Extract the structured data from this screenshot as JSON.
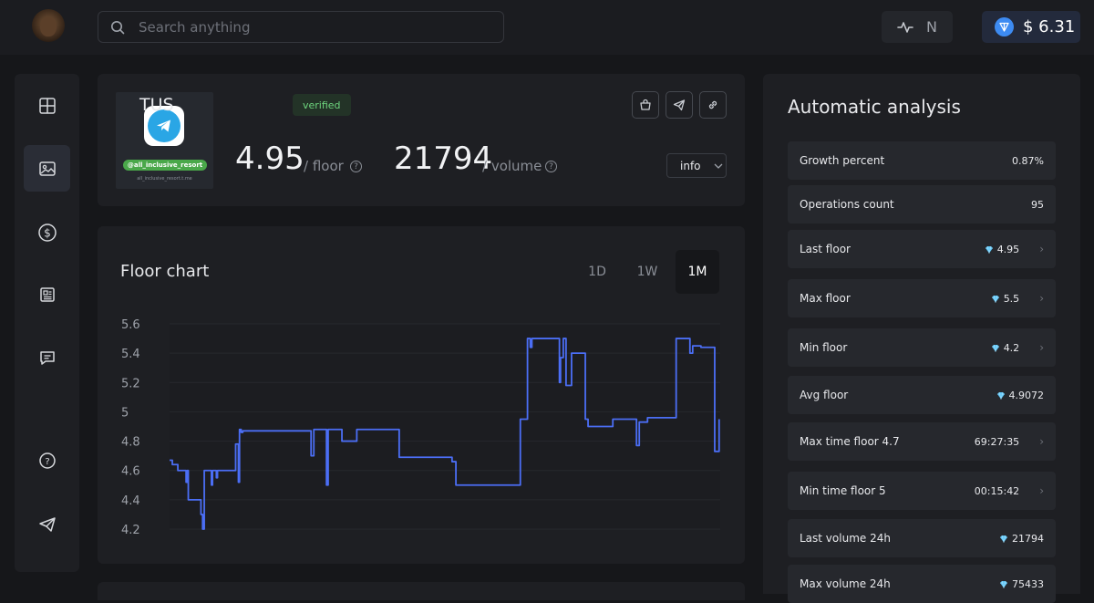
{
  "header": {
    "search_placeholder": "Search anything",
    "network_label": "N",
    "balance": "$ 6.31"
  },
  "sidebar": {
    "items": [
      {
        "icon": "grid-icon",
        "active": false
      },
      {
        "icon": "image-icon",
        "active": true
      },
      {
        "icon": "dollar-icon",
        "active": false
      },
      {
        "icon": "newspaper-icon",
        "active": false
      },
      {
        "icon": "chat-icon",
        "active": false
      },
      {
        "icon": "help-icon",
        "active": false
      },
      {
        "icon": "telegram-icon",
        "active": false
      }
    ]
  },
  "collection": {
    "thumb_tag": "@all_inclusive_resort",
    "thumb_sub": "all_inclusive_resort.t.me",
    "title": "TUS",
    "badge": "verified",
    "floor_value": "4.95",
    "floor_label": "/ floor",
    "volume_value": "21794",
    "volume_label": "/ volume",
    "info_select": "info"
  },
  "floor_chart": {
    "title": "Floor chart",
    "ranges": [
      "1D",
      "1W",
      "1M"
    ],
    "active_range": "1M"
  },
  "chart_data": {
    "type": "line",
    "title": "Floor chart",
    "yticks": [
      "5.6",
      "5.4",
      "5.2",
      "5",
      "4.8",
      "4.6",
      "4.4",
      "4.2"
    ],
    "ylim": [
      4.2,
      5.6
    ],
    "series": [
      {
        "color": "#4b6ef5",
        "points": [
          [
            0,
            4.67
          ],
          [
            0.5,
            4.64
          ],
          [
            1.5,
            4.6
          ],
          [
            2.5,
            4.6
          ],
          [
            3,
            4.52
          ],
          [
            3.2,
            4.6
          ],
          [
            3.4,
            4.4
          ],
          [
            5.5,
            4.4
          ],
          [
            5.7,
            4.3
          ],
          [
            6,
            4.2
          ],
          [
            6.3,
            4.6
          ],
          [
            7.5,
            4.6
          ],
          [
            7.6,
            4.5
          ],
          [
            7.8,
            4.6
          ],
          [
            8.5,
            4.55
          ],
          [
            8.7,
            4.6
          ],
          [
            11.5,
            4.6
          ],
          [
            12,
            4.78
          ],
          [
            12.5,
            4.52
          ],
          [
            12.7,
            4.88
          ],
          [
            13,
            4.86
          ],
          [
            13.3,
            4.87
          ],
          [
            25.5,
            4.87
          ],
          [
            25.7,
            4.7
          ],
          [
            26.2,
            4.88
          ],
          [
            28.3,
            4.88
          ],
          [
            28.5,
            4.5
          ],
          [
            28.8,
            4.88
          ],
          [
            31,
            4.88
          ],
          [
            31.3,
            4.8
          ],
          [
            33.7,
            4.8
          ],
          [
            34,
            4.88
          ],
          [
            41.5,
            4.88
          ],
          [
            41.7,
            4.69
          ],
          [
            51,
            4.69
          ],
          [
            51.3,
            4.66
          ],
          [
            52,
            4.5
          ],
          [
            63.5,
            4.5
          ],
          [
            63.7,
            4.95
          ],
          [
            64.7,
            4.95
          ],
          [
            65,
            5.5
          ],
          [
            65.5,
            5.44
          ],
          [
            65.8,
            5.5
          ],
          [
            70.5,
            5.5
          ],
          [
            70.8,
            5.2
          ],
          [
            71,
            5.37
          ],
          [
            71.5,
            5.5
          ],
          [
            72,
            5.18
          ],
          [
            73,
            5.4
          ],
          [
            75,
            5.4
          ],
          [
            75.5,
            4.95
          ],
          [
            76,
            4.9
          ],
          [
            77.5,
            4.9
          ],
          [
            78,
            4.9
          ],
          [
            80,
            4.9
          ],
          [
            80.5,
            4.95
          ],
          [
            84.5,
            4.95
          ],
          [
            84.8,
            4.77
          ],
          [
            85.3,
            4.93
          ],
          [
            86.5,
            4.93
          ],
          [
            86.8,
            4.96
          ],
          [
            89,
            4.96
          ],
          [
            91.5,
            4.96
          ],
          [
            92,
            5.5
          ],
          [
            94,
            5.5
          ],
          [
            94.5,
            5.4
          ],
          [
            95,
            5.45
          ],
          [
            96.5,
            5.44
          ],
          [
            97,
            5.44
          ],
          [
            98.5,
            5.44
          ],
          [
            99,
            4.73
          ],
          [
            99.5,
            4.73
          ],
          [
            99.8,
            4.95
          ]
        ]
      }
    ]
  },
  "analysis": {
    "title": "Automatic analysis",
    "rows": [
      {
        "label": "Growth percent",
        "value": "0.87%",
        "ton": false,
        "chevron": false
      },
      {
        "label": "Operations count",
        "value": "95",
        "ton": false,
        "chevron": false
      },
      {
        "label": "Last floor",
        "value": "4.95",
        "ton": true,
        "chevron": true
      },
      {
        "label": "Max floor",
        "value": "5.5",
        "ton": true,
        "chevron": true
      },
      {
        "label": "Min floor",
        "value": "4.2",
        "ton": true,
        "chevron": true
      },
      {
        "label": "Avg floor",
        "value": "4.9072",
        "ton": true,
        "chevron": false
      },
      {
        "label": "Max time floor 4.7",
        "value": "69:27:35",
        "ton": false,
        "chevron": true
      },
      {
        "label": "Min time floor 5",
        "value": "00:15:42",
        "ton": false,
        "chevron": true
      },
      {
        "label": "Last volume 24h",
        "value": "21794",
        "ton": true,
        "chevron": false
      },
      {
        "label": "Max volume 24h",
        "value": "75433",
        "ton": true,
        "chevron": false
      }
    ]
  }
}
